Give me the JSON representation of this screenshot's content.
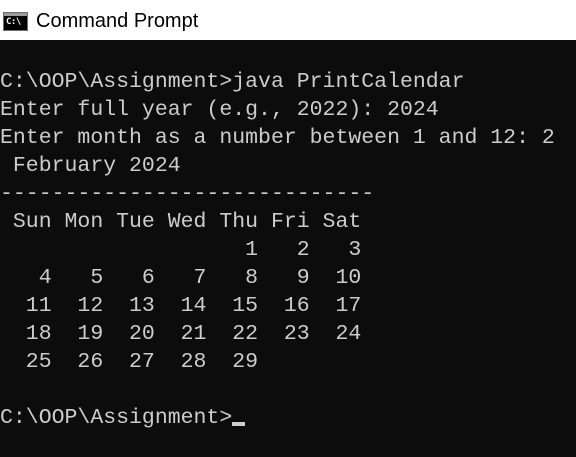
{
  "window": {
    "title": "Command Prompt",
    "icon_label": "C:\\",
    "icon": "command-prompt-icon"
  },
  "console": {
    "lines": [
      "C:\\OOP\\Assignment>java PrintCalendar",
      "Enter full year (e.g., 2022): 2024",
      "Enter month as a number between 1 and 12: 2",
      " February 2024",
      "-----------------------------",
      " Sun Mon Tue Wed Thu Fri Sat",
      "                   1   2   3",
      "   4   5   6   7   8   9  10",
      "  11  12  13  14  15  16  17",
      "  18  19  20  21  22  23  24",
      "  25  26  27  28  29",
      "",
      "C:\\OOP\\Assignment>"
    ]
  },
  "colors": {
    "console_background": "#0c0c0c",
    "console_text": "#cccccc",
    "titlebar_background": "#ffffff"
  }
}
